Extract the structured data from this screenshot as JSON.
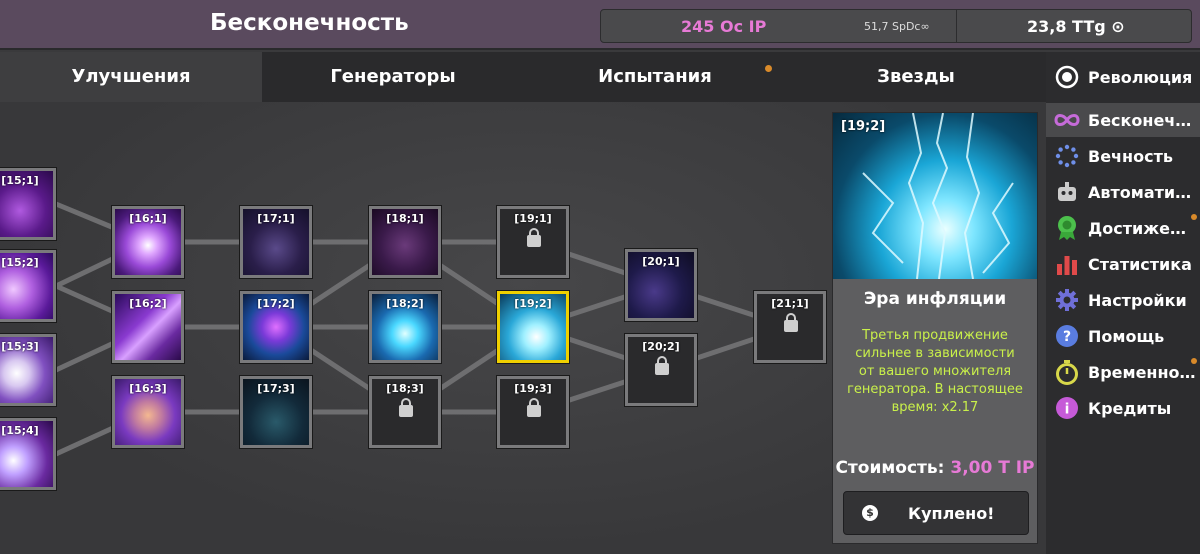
{
  "header": {
    "title": "Бесконечность",
    "ip": "245 Oc IP",
    "speed": "51,7 SpDc∞",
    "ttg": "23,8 TTg ⊙"
  },
  "tabs": [
    {
      "label": "Улучшения",
      "active": true
    },
    {
      "label": "Генераторы",
      "active": false
    },
    {
      "label": "Испытания",
      "active": false,
      "notify": true
    },
    {
      "label": "Звезды",
      "active": false
    }
  ],
  "sidebar": {
    "items": [
      {
        "label": "Революция",
        "icon": "target-icon",
        "color": "#ffffff"
      },
      {
        "label": "Бесконечность",
        "icon": "infinity-icon",
        "color": "#c66bd9",
        "active": true
      },
      {
        "label": "Вечность",
        "icon": "dots-circle-icon",
        "color": "#6f8fe8"
      },
      {
        "label": "Автоматизация",
        "icon": "robot-icon",
        "color": "#cccccc"
      },
      {
        "label": "Достижения",
        "icon": "medal-icon",
        "color": "#4cc04c",
        "notify": true
      },
      {
        "label": "Статистика",
        "icon": "bar-chart-icon",
        "color": "#e04a4a"
      },
      {
        "label": "Настройки",
        "icon": "gear-icon",
        "color": "#6f6fd8"
      },
      {
        "label": "Помощь",
        "icon": "question-icon",
        "color": "#5a7de0"
      },
      {
        "label": "Временной разлом",
        "icon": "stopwatch-icon",
        "color": "#d8d84a",
        "notify": true
      },
      {
        "label": "Кредиты",
        "icon": "info-icon",
        "color": "#c65ad8"
      }
    ]
  },
  "tree": {
    "nodes": [
      {
        "id": "[15;1]",
        "state": "bought",
        "art": "purple-hex"
      },
      {
        "id": "[15;2]",
        "state": "bought",
        "art": "cards"
      },
      {
        "id": "[15;3]",
        "state": "bought",
        "art": "white-swirl"
      },
      {
        "id": "[15;4]",
        "state": "bought",
        "art": "lightning-purple"
      },
      {
        "id": "[16;1]",
        "state": "bought",
        "art": "vortex"
      },
      {
        "id": "[16;2]",
        "state": "bought",
        "art": "purple-wind"
      },
      {
        "id": "[16;3]",
        "state": "bought",
        "art": "fist"
      },
      {
        "id": "[17;1]",
        "state": "bought",
        "art": "dark-swirl"
      },
      {
        "id": "[17;2]",
        "state": "bought",
        "art": "cube"
      },
      {
        "id": "[17;3]",
        "state": "bought",
        "art": "dark-pyramid"
      },
      {
        "id": "[18;1]",
        "state": "bought",
        "art": "dark-spiral"
      },
      {
        "id": "[18;2]",
        "state": "bought",
        "art": "blue-flames"
      },
      {
        "id": "[18;3]",
        "state": "locked"
      },
      {
        "id": "[19;1]",
        "state": "locked"
      },
      {
        "id": "[19;2]",
        "state": "selected",
        "art": "lightning-blue"
      },
      {
        "id": "[19;3]",
        "state": "locked"
      },
      {
        "id": "[20;1]",
        "state": "bought",
        "art": "stars"
      },
      {
        "id": "[20;2]",
        "state": "locked"
      },
      {
        "id": "[21;1]",
        "state": "locked"
      }
    ]
  },
  "detail": {
    "id": "[19;2]",
    "name": "Эра инфляции",
    "description": "Третья продвижение сильнее в зависимости от вашего множителя генератора. В настоящее время: x2.17",
    "cost_label": "Стоимость:",
    "cost_value": "3,00 T IP",
    "buy_label": "Куплено!",
    "buy_icon": "$"
  },
  "colors": {
    "accent_pink": "#e77ad6",
    "desc_green": "#c9f04a",
    "selected_border": "#f0d000",
    "notify_dot": "#d98a2a"
  }
}
